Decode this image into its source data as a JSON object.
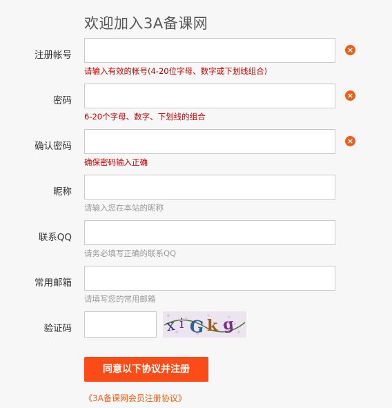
{
  "page_title": "欢迎加入3A备课网",
  "fields": [
    {
      "label": "注册帐号",
      "hint": "请输入有效的帐号(4-20位字母、数字或下划线组合)",
      "hint_type": "error",
      "value": ""
    },
    {
      "label": "密码",
      "hint": "6-20个字母、数字、下划线的组合",
      "hint_type": "error",
      "value": ""
    },
    {
      "label": "确认密码",
      "hint": "确保密码输入正确",
      "hint_type": "error",
      "value": ""
    },
    {
      "label": "昵称",
      "hint": "请输入您在本站的昵称",
      "hint_type": "tip",
      "value": ""
    },
    {
      "label": "联系QQ",
      "hint": "请务必填写正确的联系QQ",
      "hint_type": "tip",
      "value": ""
    },
    {
      "label": "常用邮箱",
      "hint": "请填写您的常用邮箱",
      "hint_type": "tip",
      "value": ""
    }
  ],
  "captcha": {
    "label": "验证码",
    "value": "",
    "image_text": "xiGkg"
  },
  "error_icon_glyph": "×",
  "submit_label": "同意以下协议并注册",
  "agreement_link": "《3A备课网会员注册协议》",
  "colors": {
    "accent": "#fb4b17",
    "error_text": "#c00000",
    "tip_text": "#999999",
    "error_icon": "#e8601c"
  }
}
